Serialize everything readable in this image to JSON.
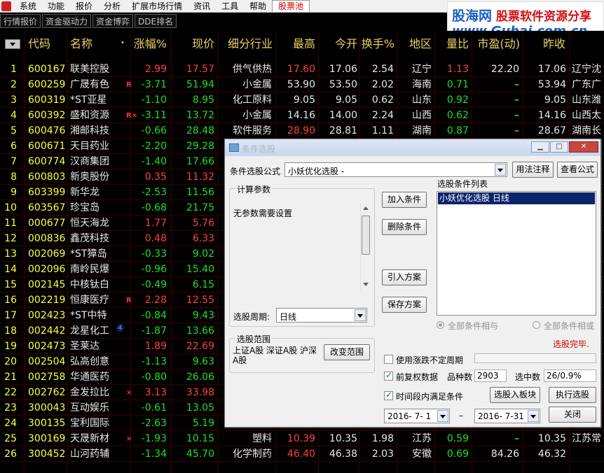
{
  "menu": [
    "系统",
    "功能",
    "报价",
    "分析",
    "扩展市场行情",
    "资讯",
    "工具",
    "帮助",
    "股票池"
  ],
  "tabs": [
    "行情报价",
    "资金驱动力",
    "资金博弈",
    "DDE排名"
  ],
  "logo": {
    "line1a": "股海网",
    "line1b": "股票软件资源分享",
    "line2": "www.Guhai.com.cn"
  },
  "headers": {
    "code": "代码",
    "name": "名称",
    "change": "涨幅%",
    "price": "现价",
    "industry": "细分行业",
    "high": "最高",
    "open": "今开",
    "turnover": "换手%",
    "region": "地区",
    "volratio": "量比",
    "pe": "市盈(动)",
    "prevclose": "昨收"
  },
  "rows": [
    {
      "no": "1",
      "code": "600167",
      "name": "联美控股",
      "flag": "",
      "change": "2.99",
      "price": "17.57",
      "industry": "供气供热",
      "high": "17.60",
      "open": "17.06",
      "turnover": "2.54",
      "region": "辽宁",
      "volratio": "1.13",
      "pe": "22.20",
      "prevclose": "17.06",
      "extra": "辽宁沈"
    },
    {
      "no": "2",
      "code": "600259",
      "name": "广晟有色",
      "flag": "R",
      "change": "-3.71",
      "price": "51.94",
      "industry": "小金属",
      "high": "53.90",
      "open": "53.50",
      "turnover": "2.02",
      "region": "海南",
      "volratio": "0.71",
      "pe": "–",
      "prevclose": "53.94",
      "extra": "广东广"
    },
    {
      "no": "3",
      "code": "600319",
      "name": "*ST亚星",
      "flag": "",
      "change": "-1.10",
      "price": "8.95",
      "industry": "化工原料",
      "high": "9.05",
      "open": "9.05",
      "turnover": "0.62",
      "region": "山东",
      "volratio": "0.92",
      "pe": "–",
      "prevclose": "9.05",
      "extra": "山东潍"
    },
    {
      "no": "4",
      "code": "600392",
      "name": "盛和资源",
      "flag": "R×",
      "change": "-3.11",
      "price": "13.72",
      "industry": "小金属",
      "high": "14.16",
      "open": "14.00",
      "turnover": "2.24",
      "region": "山西",
      "volratio": "0.62",
      "pe": "–",
      "prevclose": "14.16",
      "extra": "山西太"
    },
    {
      "no": "5",
      "code": "600476",
      "name": "湘邮科技",
      "flag": "",
      "change": "-0.66",
      "price": "28.48",
      "industry": "软件服务",
      "high": "28.90",
      "open": "28.81",
      "turnover": "1.11",
      "region": "湖南",
      "volratio": "0.87",
      "pe": "–",
      "prevclose": "28.67",
      "extra": "湖南长"
    },
    {
      "no": "6",
      "code": "600671",
      "name": "天目药业",
      "flag": "",
      "change": "-2.20",
      "price": "29.28",
      "industry": "",
      "high": "",
      "open": "",
      "turnover": "",
      "region": "",
      "volratio": "",
      "pe": "",
      "prevclose": "",
      "extra": ""
    },
    {
      "no": "7",
      "code": "600774",
      "name": "汉商集团",
      "flag": "",
      "change": "-1.40",
      "price": "17.66",
      "industry": "",
      "high": "",
      "open": "",
      "turnover": "",
      "region": "",
      "volratio": "",
      "pe": "",
      "prevclose": "",
      "extra": ""
    },
    {
      "no": "8",
      "code": "600803",
      "name": "新奥股份",
      "flag": "",
      "change": "0.35",
      "price": "11.32",
      "industry": "",
      "high": "",
      "open": "",
      "turnover": "",
      "region": "",
      "volratio": "",
      "pe": "",
      "prevclose": "",
      "extra": ""
    },
    {
      "no": "9",
      "code": "603399",
      "name": "新华龙",
      "flag": "",
      "change": "-2.53",
      "price": "11.56",
      "industry": "",
      "high": "",
      "open": "",
      "turnover": "",
      "region": "",
      "volratio": "",
      "pe": "",
      "prevclose": "",
      "extra": ""
    },
    {
      "no": "10",
      "code": "603567",
      "name": "珍宝岛",
      "flag": "",
      "change": "-0.68",
      "price": "21.75",
      "industry": "",
      "high": "",
      "open": "",
      "turnover": "",
      "region": "",
      "volratio": "",
      "pe": "",
      "prevclose": "",
      "extra": ""
    },
    {
      "no": "11",
      "code": "000677",
      "name": "恒天海龙",
      "flag": "",
      "change": "1.77",
      "price": "5.76",
      "industry": "",
      "high": "",
      "open": "",
      "turnover": "",
      "region": "",
      "volratio": "",
      "pe": "",
      "prevclose": "",
      "extra": ""
    },
    {
      "no": "12",
      "code": "000836",
      "name": "鑫茂科技",
      "flag": "",
      "change": "0.48",
      "price": "6.33",
      "industry": "",
      "high": "",
      "open": "",
      "turnover": "",
      "region": "",
      "volratio": "",
      "pe": "",
      "prevclose": "",
      "extra": ""
    },
    {
      "no": "13",
      "code": "002069",
      "name": "*ST獐岛",
      "flag": "",
      "change": "-0.33",
      "price": "9.02",
      "industry": "",
      "high": "",
      "open": "",
      "turnover": "",
      "region": "",
      "volratio": "",
      "pe": "",
      "prevclose": "",
      "extra": ""
    },
    {
      "no": "14",
      "code": "002096",
      "name": "南岭民爆",
      "flag": "",
      "change": "-0.96",
      "price": "15.40",
      "industry": "",
      "high": "",
      "open": "",
      "turnover": "",
      "region": "",
      "volratio": "",
      "pe": "",
      "prevclose": "",
      "extra": ""
    },
    {
      "no": "15",
      "code": "002145",
      "name": "中核钛白",
      "flag": "",
      "change": "-0.49",
      "price": "6.15",
      "industry": "",
      "high": "",
      "open": "",
      "turnover": "",
      "region": "",
      "volratio": "",
      "pe": "",
      "prevclose": "",
      "extra": ""
    },
    {
      "no": "16",
      "code": "002219",
      "name": "恒康医疗",
      "flag": "R",
      "change": "2.28",
      "price": "12.55",
      "industry": "",
      "high": "",
      "open": "",
      "turnover": "",
      "region": "",
      "volratio": "",
      "pe": "",
      "prevclose": "",
      "extra": ""
    },
    {
      "no": "17",
      "code": "002423",
      "name": "*ST中特",
      "flag": "",
      "change": "-0.84",
      "price": "9.43",
      "industry": "",
      "high": "",
      "open": "",
      "turnover": "",
      "region": "",
      "volratio": "",
      "pe": "",
      "prevclose": "",
      "extra": ""
    },
    {
      "no": "18",
      "code": "002442",
      "name": "龙星化工",
      "flag": "④",
      "change": "-1.87",
      "price": "13.66",
      "industry": "",
      "high": "",
      "open": "",
      "turnover": "",
      "region": "",
      "volratio": "",
      "pe": "",
      "prevclose": "",
      "extra": ""
    },
    {
      "no": "19",
      "code": "002473",
      "name": "圣莱达",
      "flag": "",
      "change": "1.89",
      "price": "22.69",
      "industry": "",
      "high": "",
      "open": "",
      "turnover": "",
      "region": "",
      "volratio": "",
      "pe": "",
      "prevclose": "",
      "extra": ""
    },
    {
      "no": "20",
      "code": "002504",
      "name": "弘高创意",
      "flag": "",
      "change": "-1.13",
      "price": "9.63",
      "industry": "",
      "high": "",
      "open": "",
      "turnover": "",
      "region": "",
      "volratio": "",
      "pe": "",
      "prevclose": "",
      "extra": ""
    },
    {
      "no": "21",
      "code": "002758",
      "name": "华通医药",
      "flag": "",
      "change": "-0.80",
      "price": "26.06",
      "industry": "",
      "high": "",
      "open": "",
      "turnover": "",
      "region": "",
      "volratio": "",
      "pe": "",
      "prevclose": "",
      "extra": ""
    },
    {
      "no": "22",
      "code": "002762",
      "name": "金发拉比",
      "flag": "×",
      "change": "3.13",
      "price": "33.98",
      "industry": "",
      "high": "",
      "open": "",
      "turnover": "",
      "region": "",
      "volratio": "",
      "pe": "",
      "prevclose": "",
      "extra": ""
    },
    {
      "no": "23",
      "code": "300043",
      "name": "互动娱乐",
      "flag": "",
      "change": "-0.61",
      "price": "13.05",
      "industry": "",
      "high": "",
      "open": "",
      "turnover": "",
      "region": "",
      "volratio": "",
      "pe": "",
      "prevclose": "",
      "extra": ""
    },
    {
      "no": "24",
      "code": "300135",
      "name": "宝利国际",
      "flag": "",
      "change": "-2.63",
      "price": "5.19",
      "industry": "",
      "high": "",
      "open": "",
      "turnover": "",
      "region": "",
      "volratio": "",
      "pe": "",
      "prevclose": "",
      "extra": ""
    },
    {
      "no": "25",
      "code": "300169",
      "name": "天晟新材",
      "flag": "×",
      "change": "-1.93",
      "price": "10.15",
      "industry": "塑料",
      "high": "10.39",
      "open": "10.35",
      "turnover": "1.98",
      "region": "江苏",
      "volratio": "0.59",
      "pe": "–",
      "prevclose": "10.35",
      "extra": "江苏常"
    },
    {
      "no": "26",
      "code": "300452",
      "name": "山河药辅",
      "flag": "",
      "change": "-1.34",
      "price": "45.70",
      "industry": "化学制药",
      "high": "46.40",
      "open": "46.38",
      "turnover": "2.03",
      "region": "安徽",
      "volratio": "0.69",
      "pe": "84.26",
      "prevclose": "46.32",
      "extra": ""
    }
  ],
  "colors": {
    "up": "#ff4040",
    "down": "#20e020",
    "header": "#e8d060",
    "code": "#ffff40"
  },
  "dialog": {
    "title": "条件选股",
    "win_min": "▁",
    "win_max": "□",
    "win_close": "✕",
    "formula_label": "条件选股公式",
    "formula_value": "小妖优化选股 -",
    "btn_usage": "用法注释",
    "btn_view": "查看公式",
    "params_group": "计算参数",
    "params_text": "无参数需要设置",
    "btn_add": "加入条件",
    "btn_delete": "删除条件",
    "btn_import": "引入方案",
    "btn_save": "保存方案",
    "cond_list_label": "选股条件列表",
    "cond_item": "小妖优化选股   日线",
    "period_label": "选股周期:",
    "period_value": "日线",
    "radio_and": "全部条件相与",
    "radio_or": "全部条件相或",
    "status": "选股完毕.",
    "range_group": "选股范围",
    "range_text": "上证A股 深证A股 沪深A股",
    "btn_change_range": "改变范围",
    "chk_undetermined": "使用涨跌不定周期",
    "chk_adjusted": "前复权数据",
    "count_label": "品种数",
    "count_value": "2903",
    "selected_label": "选中数",
    "selected_value": "26/0.9%",
    "chk_timespan": "时间段内满足条件",
    "btn_to_block": "选股入板块",
    "btn_execute": "执行选股",
    "date_from": "2016- 7- 1",
    "date_sep": "–",
    "date_to": "2016- 7-31",
    "btn_close": "关闭"
  }
}
